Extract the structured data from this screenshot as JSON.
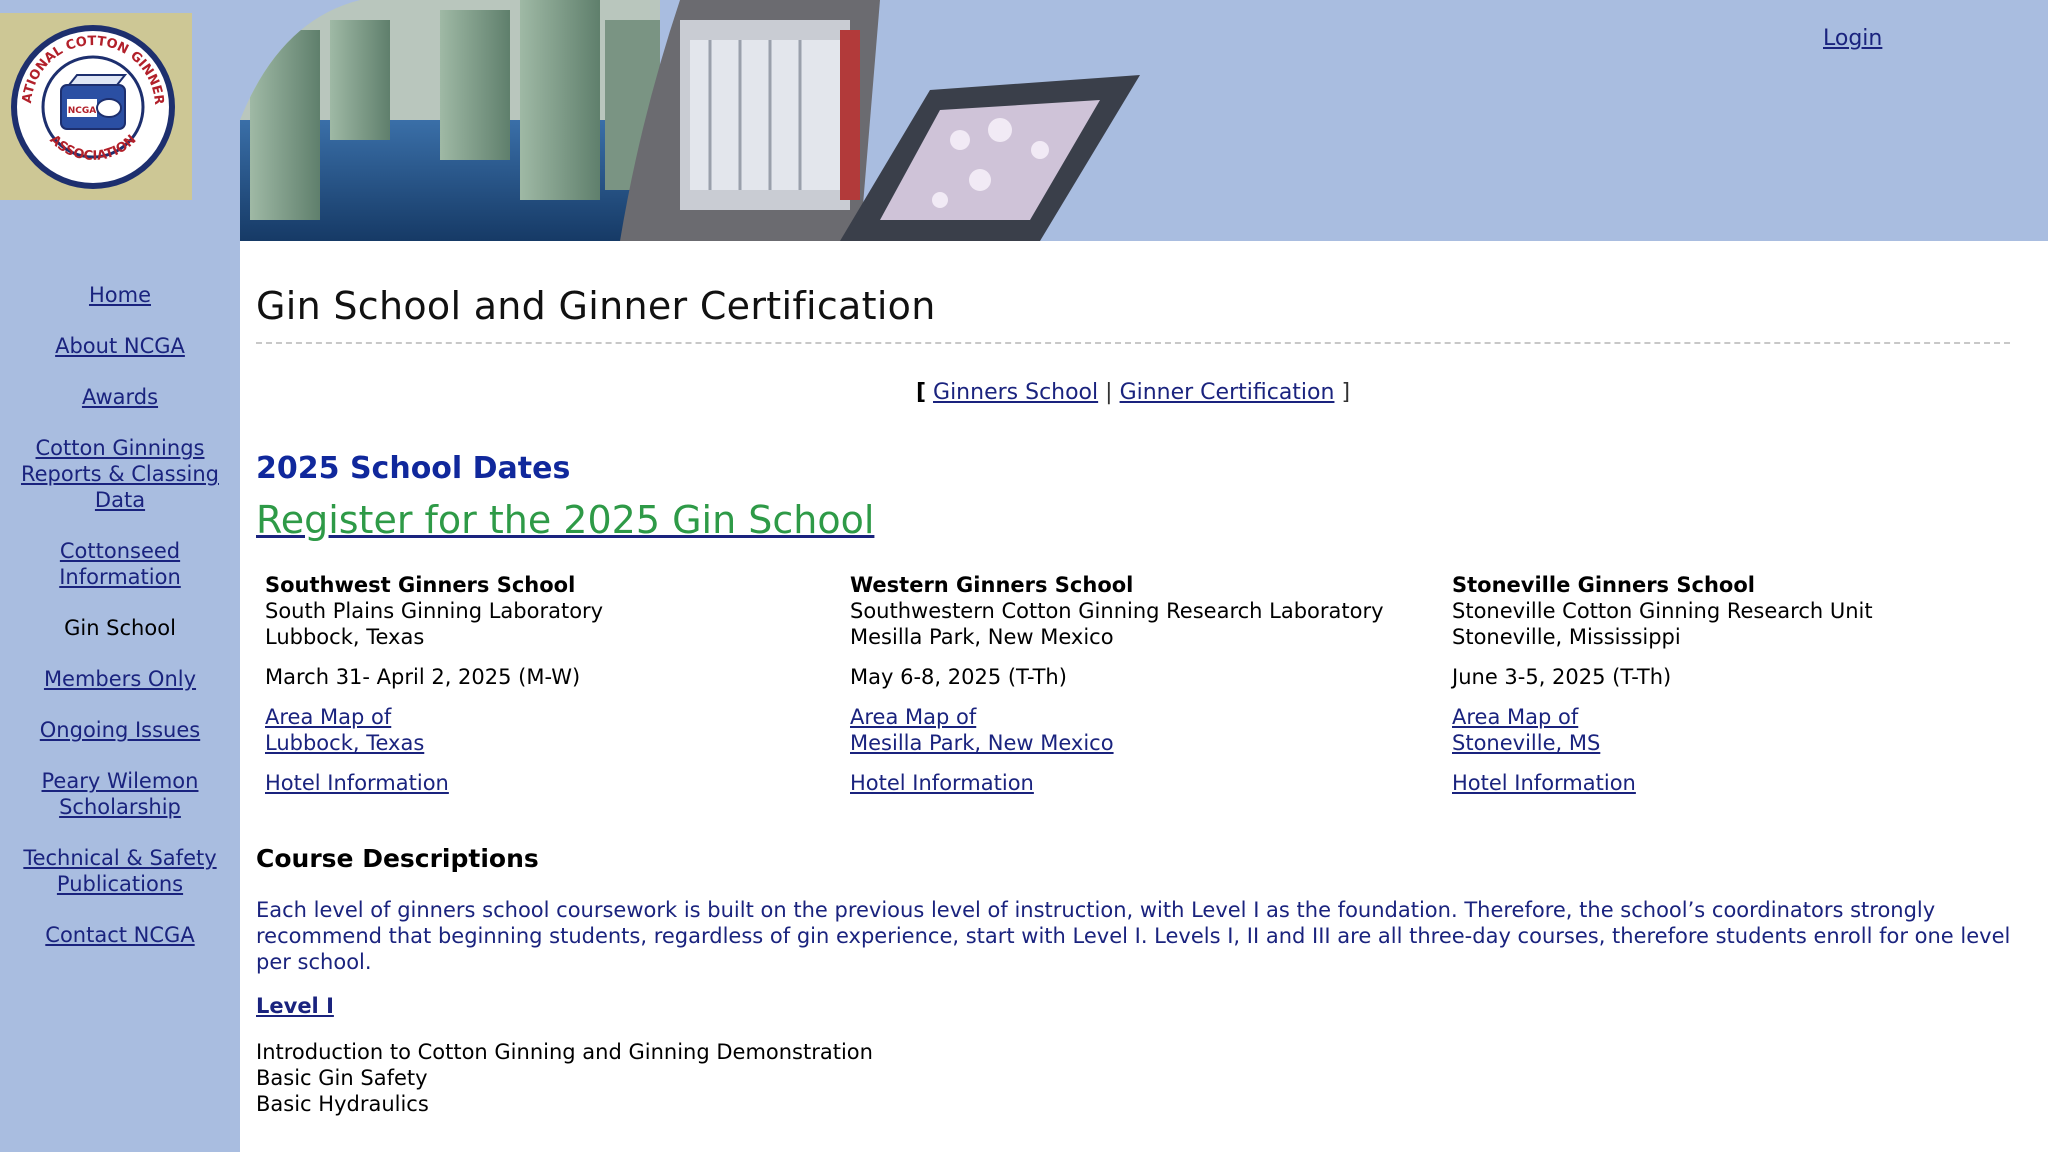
{
  "header": {
    "login_label": "Login"
  },
  "logo": {
    "text_top": "NATIONAL COTTON GINNERS",
    "text_bottom": "ASSOCIATION",
    "center": "NCGA"
  },
  "sidebar": {
    "items": [
      {
        "label": "Home",
        "active": false
      },
      {
        "label": "About NCGA",
        "active": false
      },
      {
        "label": "Awards",
        "active": false
      },
      {
        "label": "Cotton Ginnings Reports & Classing Data",
        "active": false
      },
      {
        "label": "Cottonseed Information",
        "active": false
      },
      {
        "label": "Gin School",
        "active": true
      },
      {
        "label": "Members Only",
        "active": false
      },
      {
        "label": "Ongoing Issues",
        "active": false
      },
      {
        "label": "Peary Wilemon Scholarship",
        "active": false
      },
      {
        "label": "Technical & Safety Publications",
        "active": false
      },
      {
        "label": "Contact NCGA",
        "active": false
      }
    ]
  },
  "main": {
    "title": "Gin School and Ginner Certification",
    "subnav": {
      "open": "[",
      "link1": "Ginners School",
      "sep": "|",
      "link2": "Ginner Certification",
      "close": "]"
    },
    "dates_heading": "2025 School Dates",
    "register_label": "Register for the 2025 Gin School",
    "schools": [
      {
        "name": "Southwest Ginners School",
        "lab": "South Plains Ginning Laboratory",
        "location": "Lubbock, Texas",
        "dates": "March 31- April 2, 2025 (M-W)",
        "map_line1": "Area Map of",
        "map_line2": "Lubbock, Texas",
        "hotel": "Hotel Information"
      },
      {
        "name": "Western Ginners School",
        "lab": "Southwestern Cotton Ginning Research Laboratory",
        "location": "Mesilla Park, New Mexico",
        "dates": "May 6-8, 2025 (T-Th)",
        "map_line1": "Area Map of",
        "map_line2": "Mesilla Park, New Mexico",
        "hotel": "Hotel Information"
      },
      {
        "name": "Stoneville Ginners School",
        "lab": "Stoneville Cotton Ginning Research Unit",
        "location": "Stoneville, Mississippi",
        "dates": "June 3-5, 2025 (T-Th)",
        "map_line1": "Area Map of",
        "map_line2": "Stoneville, MS",
        "hotel": "Hotel Information"
      }
    ],
    "course_heading": "Course Descriptions",
    "course_description": "Each level of ginners school coursework is built on the previous level of instruction, with Level I as the foundation. Therefore, the school’s coordinators strongly recommend that beginning students, regardless of gin experience, start with Level I.  Levels I, II and III are all three-day courses, therefore students enroll for one level per school.",
    "level_heading": "Level I",
    "level_items": [
      "Introduction to Cotton Ginning and Ginning Demonstration",
      "Basic Gin Safety",
      "Basic Hydraulics"
    ]
  },
  "colors": {
    "sidebar_bg": "#a9bde0",
    "link": "#1a237e",
    "heading_blue": "#10289c",
    "register_green": "#2e9a47"
  }
}
